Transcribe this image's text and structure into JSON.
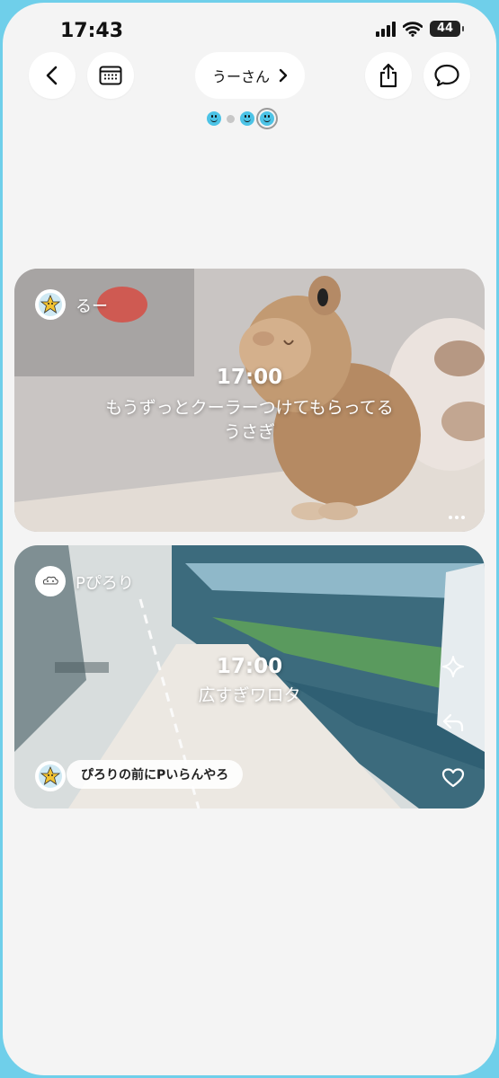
{
  "status_bar": {
    "time": "17:43",
    "battery": "44"
  },
  "header": {
    "title": "うーさん"
  },
  "posts": [
    {
      "user": "るー",
      "time": "17:00",
      "caption_line1": "もうずっとクーラーつけてもらってる",
      "caption_line2": "うさぎ"
    },
    {
      "user": "Pぴろり",
      "time": "17:00",
      "caption": "広すぎワロタ",
      "reply": "ぴろりの前にPいらんやろ"
    }
  ],
  "colors": {
    "accent": "#4cc3e6",
    "frame": "#6fcfea"
  }
}
